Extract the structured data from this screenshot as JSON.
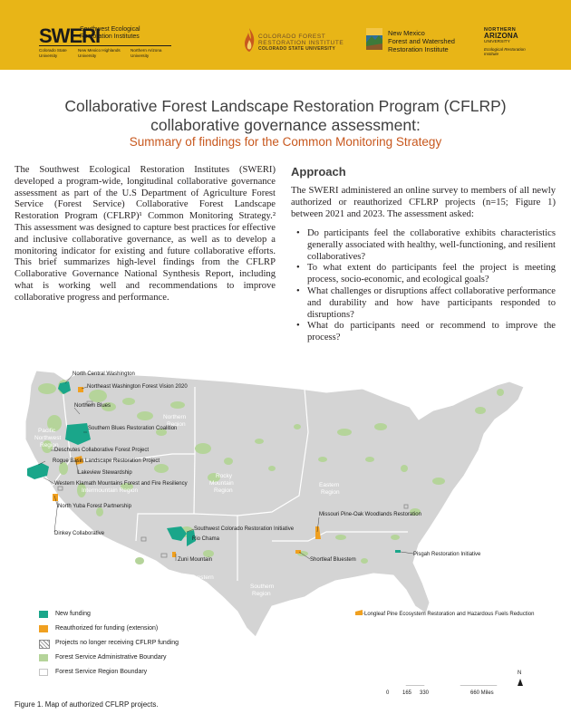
{
  "header": {
    "sweri_logo": "SWERI",
    "sweri_name": "Southwest Ecological Restoration Institutes",
    "sweri_univ_1": "Colorado State University",
    "sweri_univ_2": "New Mexico Highlands University",
    "sweri_univ_3": "Northern Arizona University",
    "cfri_line1": "COLORADO FOREST",
    "cfri_line2": "RESTORATION INSTITUTE",
    "cfri_line3": "COLORADO STATE UNIVERSITY",
    "nm_line1": "New Mexico",
    "nm_line2": "Forest and Watershed",
    "nm_line3": "Restoration Institute",
    "nau_line1": "NORTHERN",
    "nau_line2": "ARIZONA",
    "nau_line3": "UNIVERSITY",
    "nau_line4": "Ecological Restoration Institute"
  },
  "title_line1": "Collaborative Forest Landscape Restoration Program (CFLRP)",
  "title_line2": "collaborative governance assessment:",
  "subtitle": "Summary of findings for the Common Monitoring Strategy",
  "intro": "The Southwest Ecological Restoration Institutes (SWERI) developed a program-wide, longitudinal collaborative governance assessment as part of the U.S Department of Agriculture Forest Service (Forest Service) Collaborative Forest Landscape Restoration Program (CFLRP)¹ Common Monitoring Strategy.² This assessment was designed to capture best practices for effective and inclusive collaborative governance, as well as to develop a monitoring indicator for existing and future collaborative efforts. This brief summarizes high-level findings from the CFLRP Collaborative Governance National Synthesis Report, including what is working well and recommendations to improve collaborative progress and performance.",
  "approach": {
    "heading": "Approach",
    "paragraph": "The SWERI administered an online survey to members of all newly authorized or reauthorized CFLRP projects (n=15; Figure 1) between 2021 and 2023. The assessment asked:",
    "questions": [
      "Do participants feel the collaborative exhibits characteristics generally associated with healthy, well-functioning, and resilient collaboratives?",
      "To what extent do participants feel the project is meeting process, socio-economic, and ecological goals?",
      "What challenges or disruptions affect collaborative performance and durability and how have participants responded to disruptions?",
      "What do participants need or recommend to improve the process?"
    ]
  },
  "map": {
    "regions": {
      "northern": [
        "Northern",
        "Region"
      ],
      "pnw": [
        "Pacific",
        "Northwest",
        "Region"
      ],
      "intermountain": [
        "Intermountain Region"
      ],
      "rocky": [
        "Rocky",
        "Mountain",
        "Region"
      ],
      "eastern": [
        "Eastern",
        "Region"
      ],
      "psw": [
        "Pacific",
        "Southwest",
        "Region"
      ],
      "southwestern": [
        "Southwestern",
        "Region"
      ],
      "southern": [
        "Southern",
        "Region"
      ]
    },
    "projects": {
      "north_central_washington": "North Central Washington",
      "northeast_washington": "Northeast Washington Forest Vision 2020",
      "northern_blues": "Northern Blues",
      "southern_blues": "Southern Blues Restoration Coalition",
      "deschutes": "Deschutes Collaborative Forest Project",
      "rogue_basin": "Rogue Basin Landscape Restoration Project",
      "lakeview": "Lakeview Stewardship",
      "western_klamath": "Western Klamath Mountains Forest and Fire Resiliency",
      "north_yuba": "North Yuba Forest Partnership",
      "dinkey": "Dinkey Collaborative",
      "sw_colorado": "Southwest Colorado Restoration Initiative",
      "rio_chama": "Rio Chama",
      "zuni_mountain": "Zuni Mountain",
      "missouri_pine_oak": "Missouri Pine-Oak Woodlands Restoration",
      "shortleaf_bluestem": "Shortleaf Bluestem",
      "pisgah": "Pisgah Restoration Initiative",
      "longleaf_pine": "Longleaf Pine Ecosystem Restoration and Hazardous Fuels Reduction"
    },
    "legend": {
      "new_funding": "New funding",
      "reauthorized": "Reauthorized for funding (extension)",
      "no_longer": "Projects no longer receiving CFLRP funding",
      "admin_boundary": "Forest Service Administrative Boundary",
      "region_boundary": "Forest Service Region Boundary"
    },
    "scale": {
      "t0": "0",
      "t1": "165",
      "t2": "330",
      "t3": "660 Miles"
    },
    "north_arrow": "N",
    "colors": {
      "new_funding": "#1aa68a",
      "reauthorized": "#f0a020",
      "admin_boundary": "#b5d49a",
      "land": "#d4d4d4"
    }
  },
  "caption": "Figure 1. Map of authorized CFLRP projects."
}
